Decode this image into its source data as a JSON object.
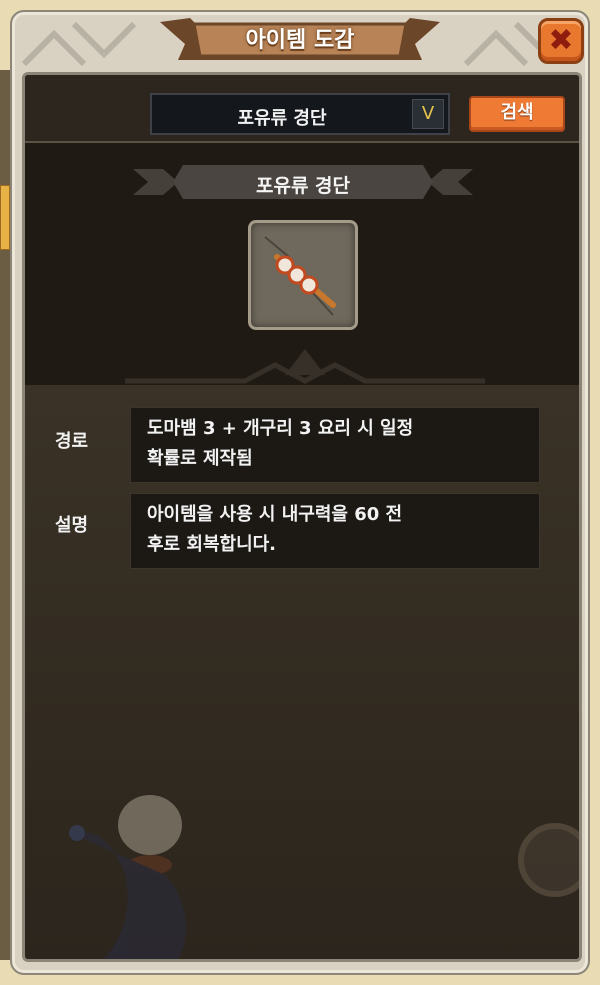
{
  "window": {
    "title": "아이템 도감",
    "close_icon": "close-icon"
  },
  "search": {
    "selected": "포유류 경단",
    "dropdown_icon": "chevron-down-icon",
    "button_label": "검색"
  },
  "item": {
    "name": "포유류 경단",
    "icon": "skewer-food-icon"
  },
  "details": [
    {
      "label": "경로",
      "lines": [
        "도마뱀 3 + 개구리 3 요리 시 일정",
        "확률로 제작됨"
      ]
    },
    {
      "label": "설명",
      "lines": [
        "아이템을 사용 시 내구력을 60 전",
        "후로 회복합니다."
      ]
    }
  ],
  "colors": {
    "accent_orange": "#ee7a34",
    "panel_dark": "#2f2920",
    "frame_light": "#d9d2c3"
  }
}
